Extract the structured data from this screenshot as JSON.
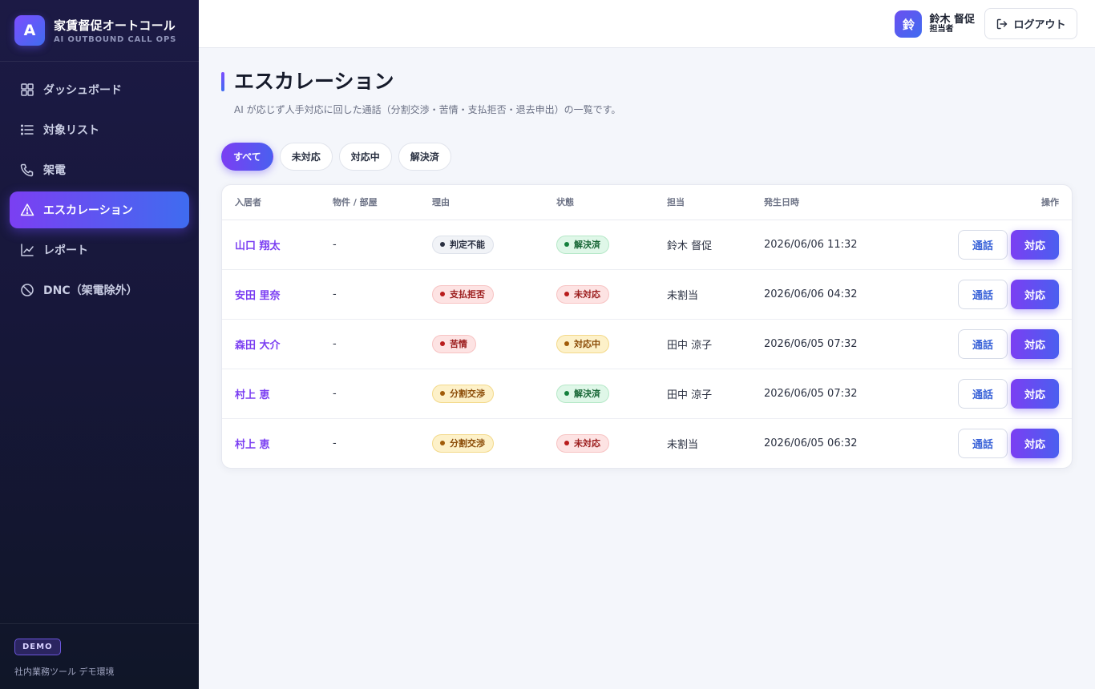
{
  "brand": {
    "logo": "A",
    "title": "家賃督促オートコール",
    "subtitle": "AI OUTBOUND CALL OPS"
  },
  "nav": [
    {
      "label": "ダッシュボード",
      "icon": "dashboard-icon"
    },
    {
      "label": "対象リスト",
      "icon": "list-icon"
    },
    {
      "label": "架電",
      "icon": "phone-icon"
    },
    {
      "label": "エスカレーション",
      "icon": "alert-triangle-icon",
      "active": true
    },
    {
      "label": "レポート",
      "icon": "chart-line-icon"
    },
    {
      "label": "DNC（架電除外）",
      "icon": "ban-icon"
    }
  ],
  "footer": {
    "badge": "DEMO",
    "text": "社内業務ツール デモ環境"
  },
  "user": {
    "avatar": "鈴",
    "name": "鈴木 督促",
    "role": "担当者"
  },
  "logout_label": "ログアウト",
  "page": {
    "title": "エスカレーション",
    "description": "AI が応じず人手対応に回した通話（分割交渉・苦情・支払拒否・退去申出）の一覧です。"
  },
  "filters": [
    "すべて",
    "未対応",
    "対応中",
    "解決済"
  ],
  "active_filter": "すべて",
  "table": {
    "headers": [
      "入居者",
      "物件 / 部屋",
      "理由",
      "状態",
      "担当",
      "発生日時",
      "操作"
    ],
    "call_label": "通話",
    "handle_label": "対応",
    "rows": [
      {
        "tenant": "山口 翔太",
        "property": "-",
        "reason": "判定不能",
        "status": "解決済",
        "assignee": "鈴木 督促",
        "datetime": "2026/06/06 11:32"
      },
      {
        "tenant": "安田 里奈",
        "property": "-",
        "reason": "支払拒否",
        "status": "未対応",
        "assignee": "未割当",
        "datetime": "2026/06/06 04:32"
      },
      {
        "tenant": "森田 大介",
        "property": "-",
        "reason": "苦情",
        "status": "対応中",
        "assignee": "田中 涼子",
        "datetime": "2026/06/05 07:32"
      },
      {
        "tenant": "村上 恵",
        "property": "-",
        "reason": "分割交渉",
        "status": "解決済",
        "assignee": "田中 涼子",
        "datetime": "2026/06/05 07:32"
      },
      {
        "tenant": "村上 恵",
        "property": "-",
        "reason": "分割交渉",
        "status": "未対応",
        "assignee": "未割当",
        "datetime": "2026/06/05 06:32"
      }
    ]
  },
  "colors": {
    "accent_start": "#7b3ff2",
    "accent_end": "#3f6cf0",
    "sidebar_bg": "#1c1a45",
    "status_resolved": "#166534",
    "status_open": "#9b1c1c",
    "status_in_progress": "#8a4a06"
  }
}
